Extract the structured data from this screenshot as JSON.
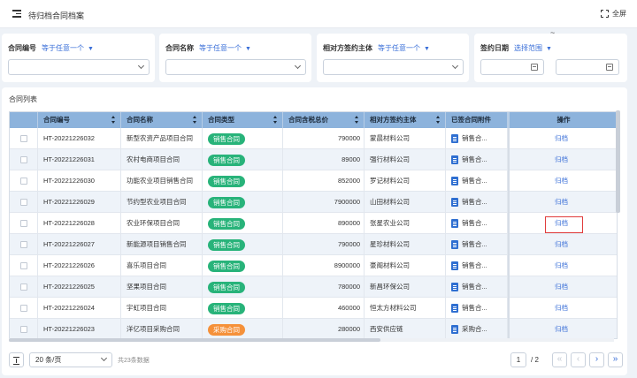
{
  "header": {
    "title": "待归档合同档案",
    "fullscreen_label": "全屏"
  },
  "filters": {
    "contract_no": {
      "label": "合同编号",
      "mode": "等于任意一个"
    },
    "contract_name": {
      "label": "合同名称",
      "mode": "等于任意一个"
    },
    "counterparty": {
      "label": "相对方签约主体",
      "mode": "等于任意一个"
    },
    "sign_date": {
      "label": "签约日期",
      "mode": "选择范围",
      "separator": "~"
    }
  },
  "list": {
    "title": "合同列表",
    "columns": [
      "合同编号",
      "合同名称",
      "合同类型",
      "合同含税总价",
      "相对方签约主体",
      "已签合同附件",
      "操作"
    ],
    "rows": [
      {
        "no": "HT-20221226032",
        "name": "新型农资产品项目合同",
        "type": "销售合同",
        "type_kind": "sale",
        "price": "790000",
        "party": "蒙晨材料公司",
        "attachment": "销售合...",
        "action": "归档"
      },
      {
        "no": "HT-20221226031",
        "name": "农村电商项目合同",
        "type": "销售合同",
        "type_kind": "sale",
        "price": "89000",
        "party": "强行材料公司",
        "attachment": "销售合...",
        "action": "归档"
      },
      {
        "no": "HT-20221226030",
        "name": "功能农业项目销售合同",
        "type": "销售合同",
        "type_kind": "sale",
        "price": "852000",
        "party": "罗记材料公司",
        "attachment": "销售合...",
        "action": "归档"
      },
      {
        "no": "HT-20221226029",
        "name": "节约型农业项目合同",
        "type": "销售合同",
        "type_kind": "sale",
        "price": "7900000",
        "party": "山田材料公司",
        "attachment": "销售合...",
        "action": "归档"
      },
      {
        "no": "HT-20221226028",
        "name": "农业环保项目合同",
        "type": "销售合同",
        "type_kind": "sale",
        "price": "890000",
        "party": "张星农业公司",
        "attachment": "销售合...",
        "action": "归档"
      },
      {
        "no": "HT-20221226027",
        "name": "新能源项目销售合同",
        "type": "销售合同",
        "type_kind": "sale",
        "price": "790000",
        "party": "星珍材料公司",
        "attachment": "销售合...",
        "action": "归档"
      },
      {
        "no": "HT-20221226026",
        "name": "喜乐项目合同",
        "type": "销售合同",
        "type_kind": "sale",
        "price": "8900000",
        "party": "豪阁材料公司",
        "attachment": "销售合...",
        "action": "归档"
      },
      {
        "no": "HT-20221226025",
        "name": "坚果项目合同",
        "type": "销售合同",
        "type_kind": "sale",
        "price": "780000",
        "party": "新昌环保公司",
        "attachment": "销售合...",
        "action": "归档"
      },
      {
        "no": "HT-20221226024",
        "name": "宇虹项目合同",
        "type": "销售合同",
        "type_kind": "sale",
        "price": "460000",
        "party": "恒太方材料公司",
        "attachment": "销售合...",
        "action": "归档"
      },
      {
        "no": "HT-20221226023",
        "name": "洋亿项目采购合同",
        "type": "采购合同",
        "type_kind": "buy",
        "price": "280000",
        "party": "西安供应链",
        "attachment": "采购合...",
        "action": "归档"
      }
    ]
  },
  "footer": {
    "page_size": "20 条/页",
    "total": "共23条数据",
    "current_page": "1",
    "total_pages": "/ 2",
    "first_icon": "«",
    "prev_icon": "‹",
    "next_icon": "›",
    "last_icon": "»"
  },
  "colors": {
    "header_bg": "#8db3dc",
    "accent": "#3a6fd8",
    "sale_tag": "#28b37a",
    "buy_tag": "#f5913a",
    "highlight": "#e03c3c"
  }
}
